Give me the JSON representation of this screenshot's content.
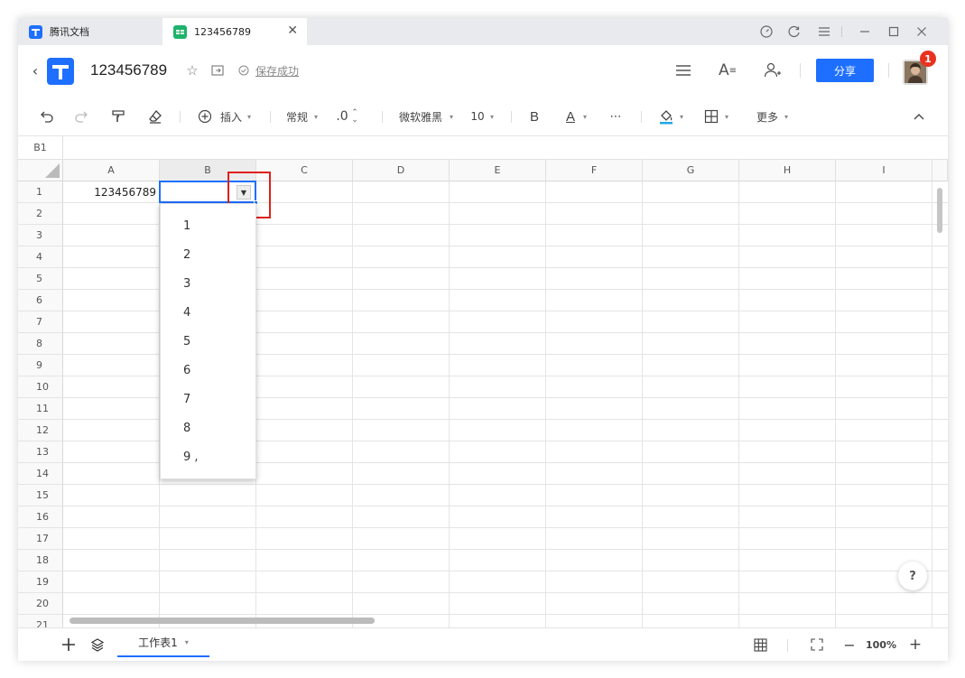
{
  "tabs": [
    {
      "label": "腾讯文档"
    },
    {
      "label": "123456789"
    }
  ],
  "header": {
    "doc_title": "123456789",
    "save_status": "保存成功",
    "share_label": "分享",
    "badge_count": "1"
  },
  "toolbar": {
    "insert_label": "插入",
    "format_label": "常规",
    "decimal_label": ".0",
    "font_label": "微软雅黑",
    "size_label": "10",
    "bold_label": "B",
    "fontcolor_label": "A",
    "more_label": "更多"
  },
  "formula_bar": {
    "cell_ref": "B1",
    "value": ""
  },
  "grid": {
    "columns": [
      "A",
      "B",
      "C",
      "D",
      "E",
      "F",
      "G",
      "H",
      "I"
    ],
    "rows": [
      "1",
      "2",
      "3",
      "4",
      "5",
      "6",
      "7",
      "8",
      "9",
      "10",
      "11",
      "12",
      "13",
      "14",
      "15",
      "16",
      "17",
      "18",
      "19",
      "20",
      "21"
    ],
    "cell_A1": "123456789",
    "selected_cell": "B1"
  },
  "dropdown": {
    "items": [
      "1",
      "2",
      "3",
      "4",
      "5",
      "6",
      "7",
      "8",
      "9 ,"
    ]
  },
  "bottom": {
    "sheet_name": "工作表1",
    "zoom": "100%"
  },
  "colors": {
    "accent": "#1e6fff",
    "highlight": "#e0201a",
    "badge": "#e8321f"
  }
}
